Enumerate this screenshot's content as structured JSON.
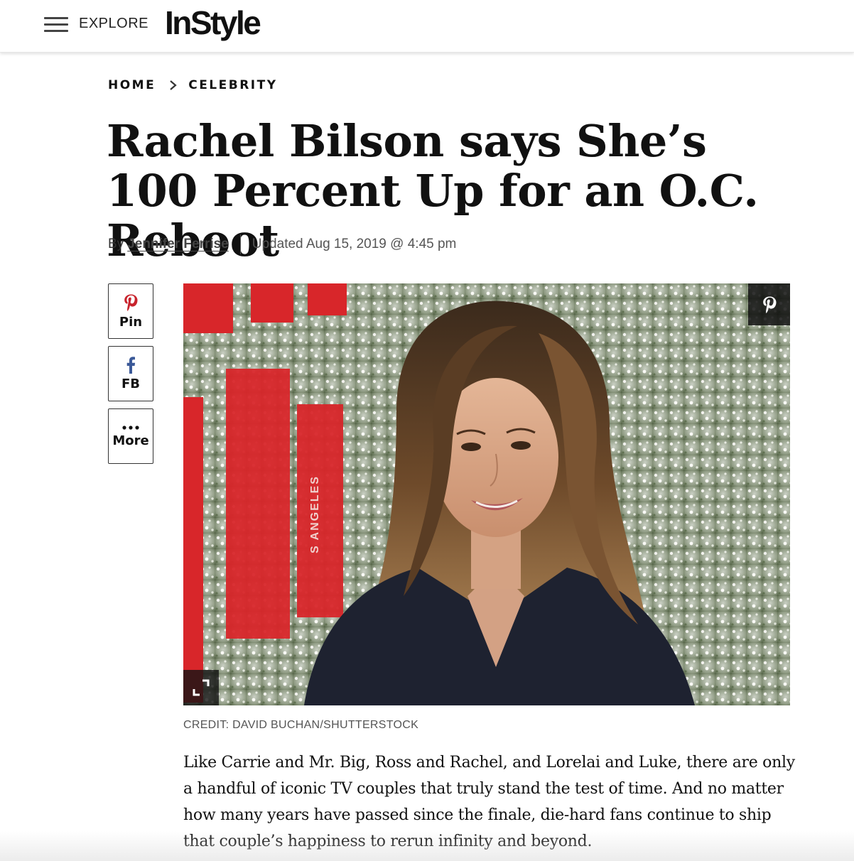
{
  "header": {
    "explore_label": "EXPLORE",
    "logo_text": "InStyle"
  },
  "breadcrumb": {
    "home": "HOME",
    "section": "CELEBRITY"
  },
  "article": {
    "headline": "Rachel Bilson says She’s 100 Percent Up for an O.C. Reboot",
    "by_label": "By",
    "author": "Jennifer Ferrise",
    "updated": "Updated Aug 15, 2019 @ 4:45 pm",
    "image_credit": "CREDIT: DAVID BUCHAN/SHUTTERSTOCK",
    "body_paragraph": "Like Carrie and Mr. Big, Ross and Rachel, and Lorelai and Luke, there are only a handful of iconic TV couples that truly stand the test of time. And no matter how many years have passed since the finale, die-hard fans continue to ship that couple’s happiness to rerun infinity and beyond."
  },
  "share": {
    "pin_label": "Pin",
    "fb_label": "FB",
    "more_label": "More"
  },
  "hero_image": {
    "backdrop_text": "S ANGELES"
  },
  "colors": {
    "pinterest_red": "#c8232c",
    "facebook_blue": "#3b5998",
    "backdrop_red": "#d8262a"
  }
}
